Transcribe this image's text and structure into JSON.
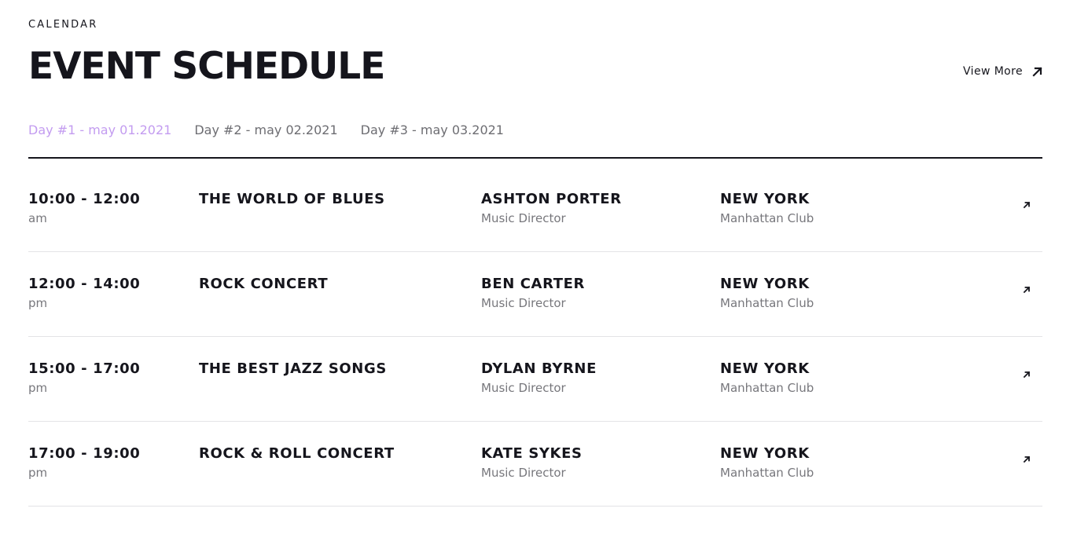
{
  "header": {
    "eyebrow": "CALENDAR",
    "title": "EVENT SCHEDULE",
    "view_more_label": "View More",
    "view_more_icon": "arrow-up-right-icon"
  },
  "tabs": [
    {
      "label": "Day #1 - may 01.2021",
      "active": true
    },
    {
      "label": "Day #2 - may 02.2021",
      "active": false
    },
    {
      "label": "Day #3 - may 03.2021",
      "active": false
    }
  ],
  "colors": {
    "active_tab": "#c39cf0",
    "text_primary": "#15151c",
    "text_secondary": "#77777c",
    "inactive_tab": "#6d6d72"
  },
  "events": [
    {
      "time": "10:00 - 12:00",
      "period": "am",
      "title": "THE WORLD OF BLUES",
      "person": "ASHTON PORTER",
      "role": "Music Director",
      "city": "NEW YORK",
      "venue": "Manhattan Club"
    },
    {
      "time": "12:00 - 14:00",
      "period": "pm",
      "title": "ROCK CONCERT",
      "person": "BEN CARTER",
      "role": "Music Director",
      "city": "NEW YORK",
      "venue": "Manhattan Club"
    },
    {
      "time": "15:00 - 17:00",
      "period": "pm",
      "title": "THE BEST JAZZ SONGS",
      "person": "DYLAN BYRNE",
      "role": "Music Director",
      "city": "NEW YORK",
      "venue": "Manhattan Club"
    },
    {
      "time": "17:00 - 19:00",
      "period": "pm",
      "title": "ROCK & ROLL CONCERT",
      "person": "KATE SYKES",
      "role": "Music Director",
      "city": "NEW YORK",
      "venue": "Manhattan Club"
    }
  ]
}
